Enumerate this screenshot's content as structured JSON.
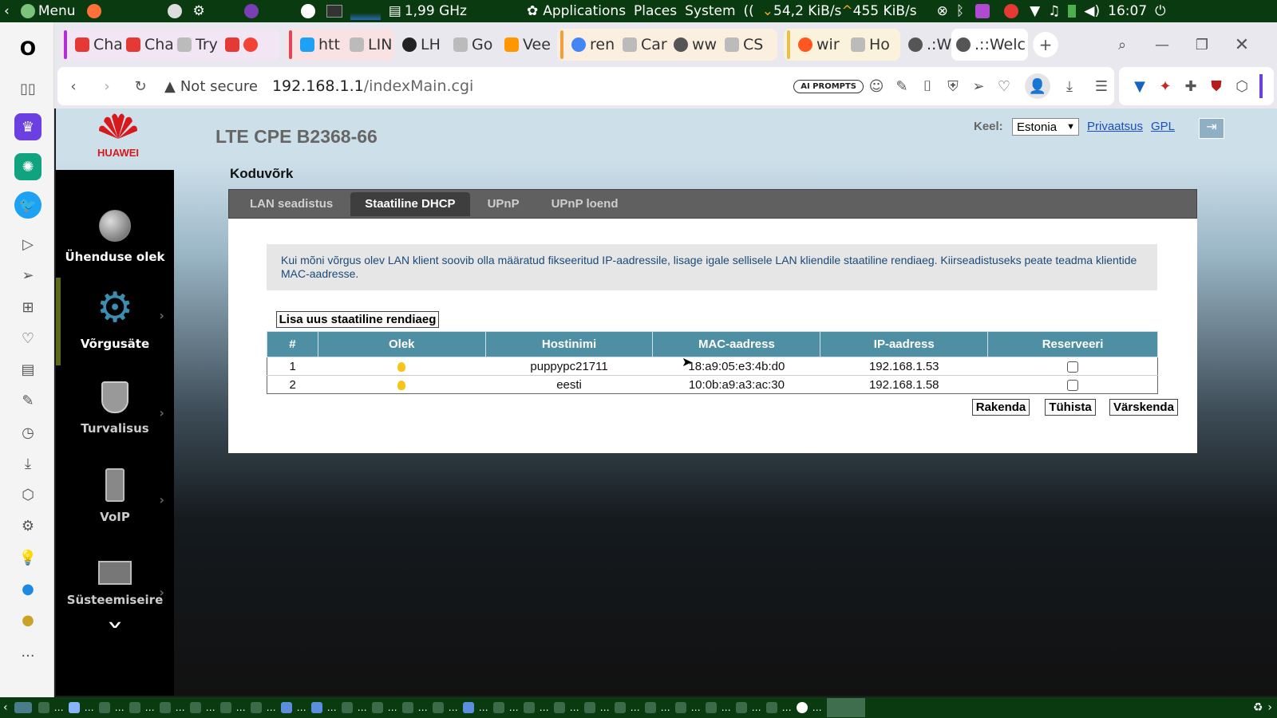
{
  "topbar": {
    "menu_label": "Menu",
    "cpu_freq": "1,99 GHz",
    "applications": "Applications",
    "places": "Places",
    "system": "System",
    "net_down": "54,2 KiB/s",
    "net_up": "455 KiB/s",
    "clock": "16:07"
  },
  "tabs": [
    {
      "title": "Cha",
      "color": "#e53935"
    },
    {
      "title": "Cha",
      "color": "#e53935"
    },
    {
      "title": "Try",
      "color": "#9e9e9e"
    },
    {
      "title": "htt",
      "color": "#1da1f2"
    },
    {
      "title": "LIN",
      "color": "#9e9e9e"
    },
    {
      "title": "LH",
      "color": "#222222"
    },
    {
      "title": "Go",
      "color": "#9e9e9e"
    },
    {
      "title": "Vee",
      "color": "#ff9800"
    },
    {
      "title": "ren",
      "color": "#4285f4"
    },
    {
      "title": "Car",
      "color": "#9e9e9e"
    },
    {
      "title": "ww",
      "color": "#555555"
    },
    {
      "title": "CS",
      "color": "#9e9e9e"
    },
    {
      "title": "wir",
      "color": "#ff5722"
    },
    {
      "title": "Ho",
      "color": "#9e9e9e"
    },
    {
      "title": ".:W",
      "color": "#555555"
    },
    {
      "title": ".::Welc",
      "color": "#555555"
    }
  ],
  "addressbar": {
    "security": "Not secure",
    "url_host": "192.168.1.1",
    "url_path": "/indexMain.cgi",
    "ai_prompts": "AI PROMPTS"
  },
  "router": {
    "brand": "HUAWEI",
    "model": "LTE CPE B2368-66",
    "lang_label": "Keel:",
    "lang_value": "Estonia",
    "privacy_link": "Privaatsus",
    "gpl_link": "GPL",
    "section_title": "Koduvõrk",
    "nav": [
      {
        "label": "Ühenduse olek"
      },
      {
        "label": "Võrgusäte"
      },
      {
        "label": "Turvalisus"
      },
      {
        "label": "VoIP"
      },
      {
        "label": "Süsteemiseire"
      }
    ],
    "tabs": [
      "LAN seadistus",
      "Staatiline DHCP",
      "UPnP",
      "UPnP loend"
    ],
    "info_text": "Kui mõni võrgus olev LAN klient soovib olla määratud fikseeritud IP-aadressile, lisage igale sellisele LAN kliendile staatiline rendiaeg. Kiirseadistuseks peate teadma klientide MAC-aadresse.",
    "add_button": "Lisa uus staatiline rendiaeg",
    "columns": [
      "#",
      "Olek",
      "Hostinimi",
      "MAC-aadress",
      "IP-aadress",
      "Reserveeri"
    ],
    "rows": [
      {
        "num": "1",
        "host": "puppypc21711",
        "mac": "18:a9:05:e3:4b:d0",
        "ip": "192.168.1.53"
      },
      {
        "num": "2",
        "host": "eesti",
        "mac": "10:0b:a9:a3:ac:30",
        "ip": "192.168.1.58"
      }
    ],
    "apply_button": "Rakenda",
    "cancel_button": "Tühista",
    "refresh_button": "Värskenda"
  }
}
